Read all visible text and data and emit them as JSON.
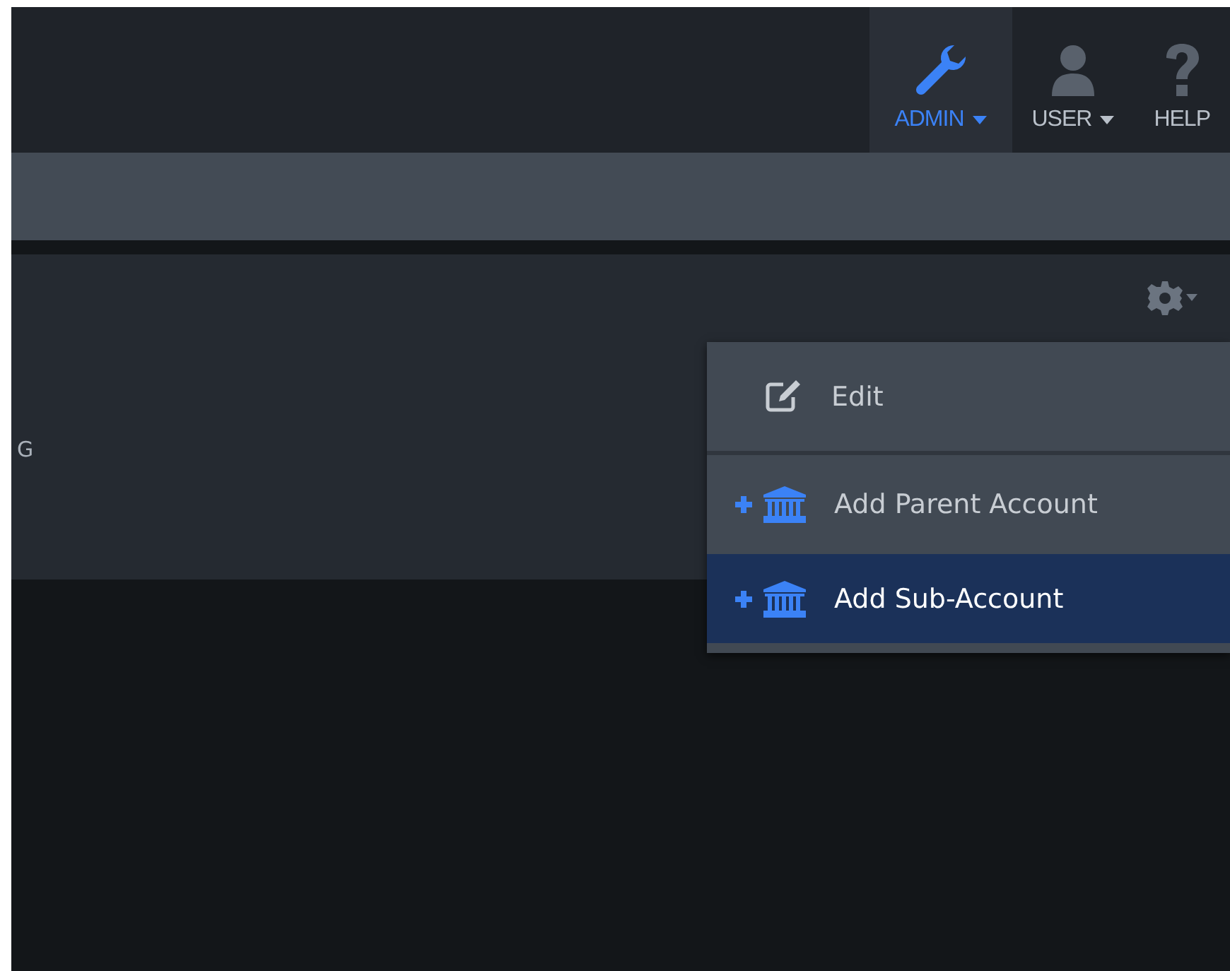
{
  "nav": [
    {
      "kind": "wrench",
      "label": "ADMIN",
      "caret": true,
      "selected": true
    },
    {
      "kind": "user",
      "label": "USER",
      "caret": true,
      "selected": false
    },
    {
      "kind": "help",
      "label": "HELP",
      "caret": false,
      "selected": false
    }
  ],
  "panel": {
    "text": "G"
  },
  "menu": [
    {
      "kind": "edit",
      "label": "Edit",
      "selected": false
    },
    {
      "kind": "add-account",
      "label": "Add Parent Account",
      "selected": false
    },
    {
      "kind": "add-account",
      "label": "Add Sub-Account",
      "selected": true
    }
  ]
}
